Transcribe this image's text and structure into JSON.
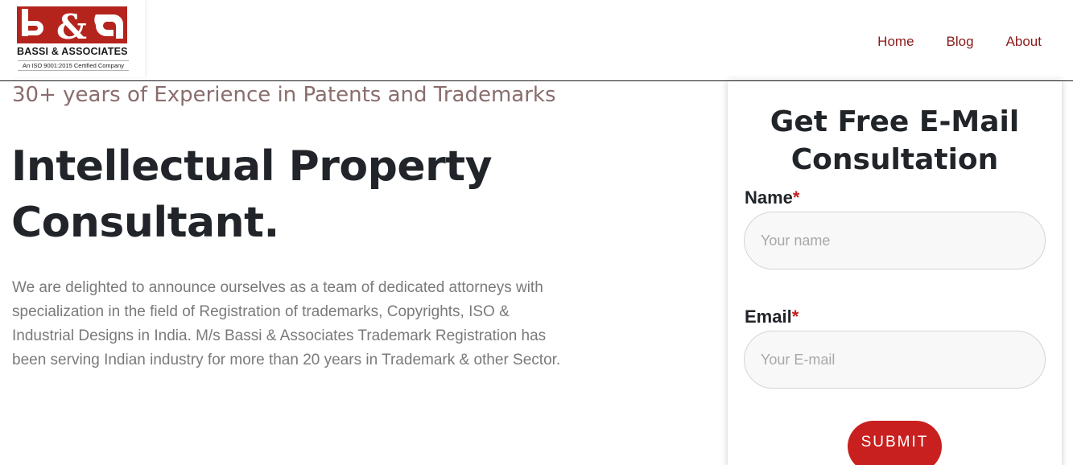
{
  "brand": {
    "name": "BASSI & ASSOCIATES",
    "tagline": "An ISO 9001:2015 Certified Company",
    "logo_color": "#b5231d"
  },
  "nav": {
    "items": [
      {
        "label": "Home"
      },
      {
        "label": "Blog"
      },
      {
        "label": "About"
      }
    ],
    "link_color": "#8b1a1a"
  },
  "hero": {
    "kicker": "30+ years of Experience in Patents and Trademarks",
    "headline_line1": "Intellectual Property",
    "headline_line2": "Consultant.",
    "body": "We are delighted to announce ourselves as a team of dedicated attorneys with specialization in the field of Registration of trademarks, Copyrights, ISO & Industrial Designs in India. M/s Bassi & Associates Trademark Registration has been serving Indian industry for more than 20 years in Trademark & other Sector."
  },
  "form": {
    "title_line1": "Get Free E-Mail",
    "title_line2": "Consultation",
    "name_label": "Name",
    "name_placeholder": "Your name",
    "email_label": "Email",
    "email_placeholder": "Your E-mail",
    "required_mark": "*",
    "submit_label": "SUBMIT",
    "button_color": "#c8201f"
  }
}
